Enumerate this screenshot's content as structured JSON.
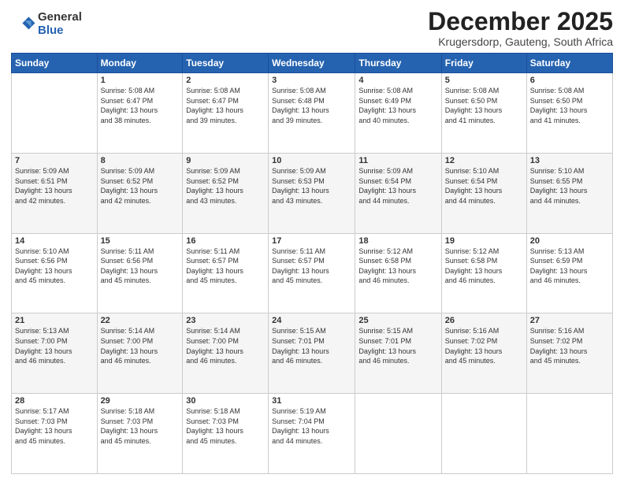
{
  "logo": {
    "general": "General",
    "blue": "Blue"
  },
  "header": {
    "month": "December 2025",
    "location": "Krugersdorp, Gauteng, South Africa"
  },
  "weekdays": [
    "Sunday",
    "Monday",
    "Tuesday",
    "Wednesday",
    "Thursday",
    "Friday",
    "Saturday"
  ],
  "weeks": [
    [
      {
        "day": "",
        "info": ""
      },
      {
        "day": "1",
        "info": "Sunrise: 5:08 AM\nSunset: 6:47 PM\nDaylight: 13 hours\nand 38 minutes."
      },
      {
        "day": "2",
        "info": "Sunrise: 5:08 AM\nSunset: 6:47 PM\nDaylight: 13 hours\nand 39 minutes."
      },
      {
        "day": "3",
        "info": "Sunrise: 5:08 AM\nSunset: 6:48 PM\nDaylight: 13 hours\nand 39 minutes."
      },
      {
        "day": "4",
        "info": "Sunrise: 5:08 AM\nSunset: 6:49 PM\nDaylight: 13 hours\nand 40 minutes."
      },
      {
        "day": "5",
        "info": "Sunrise: 5:08 AM\nSunset: 6:50 PM\nDaylight: 13 hours\nand 41 minutes."
      },
      {
        "day": "6",
        "info": "Sunrise: 5:08 AM\nSunset: 6:50 PM\nDaylight: 13 hours\nand 41 minutes."
      }
    ],
    [
      {
        "day": "7",
        "info": "Sunrise: 5:09 AM\nSunset: 6:51 PM\nDaylight: 13 hours\nand 42 minutes."
      },
      {
        "day": "8",
        "info": "Sunrise: 5:09 AM\nSunset: 6:52 PM\nDaylight: 13 hours\nand 42 minutes."
      },
      {
        "day": "9",
        "info": "Sunrise: 5:09 AM\nSunset: 6:52 PM\nDaylight: 13 hours\nand 43 minutes."
      },
      {
        "day": "10",
        "info": "Sunrise: 5:09 AM\nSunset: 6:53 PM\nDaylight: 13 hours\nand 43 minutes."
      },
      {
        "day": "11",
        "info": "Sunrise: 5:09 AM\nSunset: 6:54 PM\nDaylight: 13 hours\nand 44 minutes."
      },
      {
        "day": "12",
        "info": "Sunrise: 5:10 AM\nSunset: 6:54 PM\nDaylight: 13 hours\nand 44 minutes."
      },
      {
        "day": "13",
        "info": "Sunrise: 5:10 AM\nSunset: 6:55 PM\nDaylight: 13 hours\nand 44 minutes."
      }
    ],
    [
      {
        "day": "14",
        "info": "Sunrise: 5:10 AM\nSunset: 6:56 PM\nDaylight: 13 hours\nand 45 minutes."
      },
      {
        "day": "15",
        "info": "Sunrise: 5:11 AM\nSunset: 6:56 PM\nDaylight: 13 hours\nand 45 minutes."
      },
      {
        "day": "16",
        "info": "Sunrise: 5:11 AM\nSunset: 6:57 PM\nDaylight: 13 hours\nand 45 minutes."
      },
      {
        "day": "17",
        "info": "Sunrise: 5:11 AM\nSunset: 6:57 PM\nDaylight: 13 hours\nand 45 minutes."
      },
      {
        "day": "18",
        "info": "Sunrise: 5:12 AM\nSunset: 6:58 PM\nDaylight: 13 hours\nand 46 minutes."
      },
      {
        "day": "19",
        "info": "Sunrise: 5:12 AM\nSunset: 6:58 PM\nDaylight: 13 hours\nand 46 minutes."
      },
      {
        "day": "20",
        "info": "Sunrise: 5:13 AM\nSunset: 6:59 PM\nDaylight: 13 hours\nand 46 minutes."
      }
    ],
    [
      {
        "day": "21",
        "info": "Sunrise: 5:13 AM\nSunset: 7:00 PM\nDaylight: 13 hours\nand 46 minutes."
      },
      {
        "day": "22",
        "info": "Sunrise: 5:14 AM\nSunset: 7:00 PM\nDaylight: 13 hours\nand 46 minutes."
      },
      {
        "day": "23",
        "info": "Sunrise: 5:14 AM\nSunset: 7:00 PM\nDaylight: 13 hours\nand 46 minutes."
      },
      {
        "day": "24",
        "info": "Sunrise: 5:15 AM\nSunset: 7:01 PM\nDaylight: 13 hours\nand 46 minutes."
      },
      {
        "day": "25",
        "info": "Sunrise: 5:15 AM\nSunset: 7:01 PM\nDaylight: 13 hours\nand 46 minutes."
      },
      {
        "day": "26",
        "info": "Sunrise: 5:16 AM\nSunset: 7:02 PM\nDaylight: 13 hours\nand 45 minutes."
      },
      {
        "day": "27",
        "info": "Sunrise: 5:16 AM\nSunset: 7:02 PM\nDaylight: 13 hours\nand 45 minutes."
      }
    ],
    [
      {
        "day": "28",
        "info": "Sunrise: 5:17 AM\nSunset: 7:03 PM\nDaylight: 13 hours\nand 45 minutes."
      },
      {
        "day": "29",
        "info": "Sunrise: 5:18 AM\nSunset: 7:03 PM\nDaylight: 13 hours\nand 45 minutes."
      },
      {
        "day": "30",
        "info": "Sunrise: 5:18 AM\nSunset: 7:03 PM\nDaylight: 13 hours\nand 45 minutes."
      },
      {
        "day": "31",
        "info": "Sunrise: 5:19 AM\nSunset: 7:04 PM\nDaylight: 13 hours\nand 44 minutes."
      },
      {
        "day": "",
        "info": ""
      },
      {
        "day": "",
        "info": ""
      },
      {
        "day": "",
        "info": ""
      }
    ]
  ]
}
